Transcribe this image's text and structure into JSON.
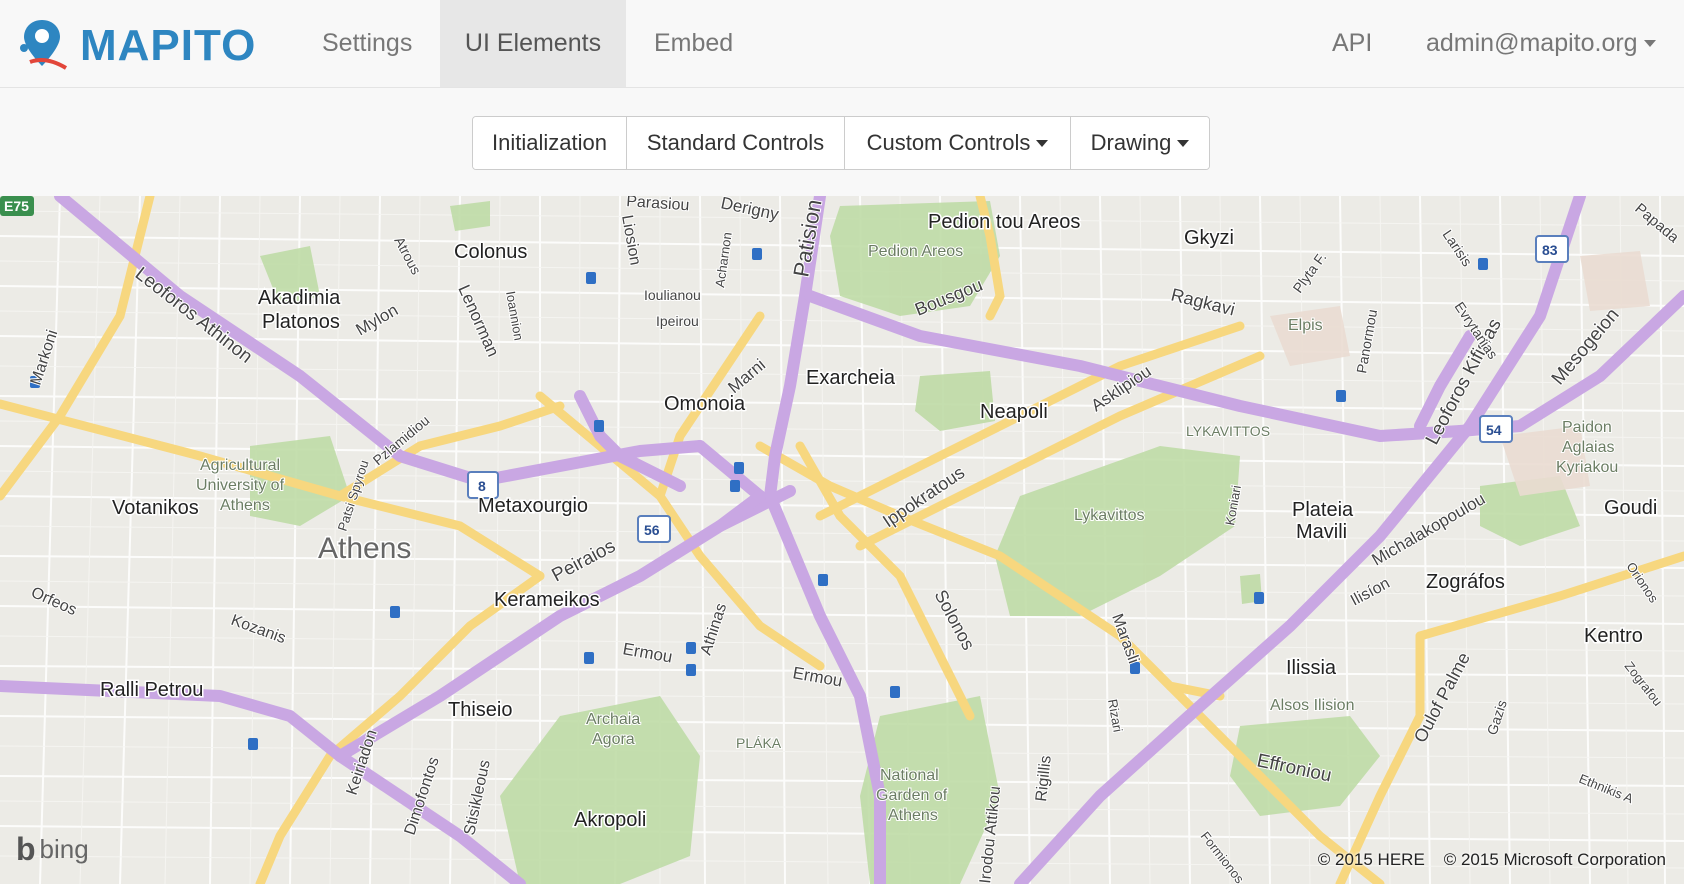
{
  "navbar": {
    "brand": "MAPITO",
    "links": [
      {
        "label": "Settings"
      },
      {
        "label": "UI Elements",
        "active": true
      },
      {
        "label": "Embed"
      }
    ],
    "api_label": "API",
    "user_label": "admin@mapito.org"
  },
  "toolbar": {
    "buttons": [
      {
        "label": "Initialization"
      },
      {
        "label": "Standard Controls"
      },
      {
        "label": "Custom Controls"
      },
      {
        "label": "Drawing"
      }
    ]
  },
  "map": {
    "labels": {
      "colonus": "Colonus",
      "akadimia": "Akadimia",
      "platonos": "Platonos",
      "omonoia": "Omonoia",
      "exarcheia": "Exarcheia",
      "neapoli": "Neapoli",
      "pedion_tou_areos": "Pedion tou Areos",
      "pedion_areos": "Pedion Areos",
      "gkyzi": "Gkyzi",
      "elpis": "Elpis",
      "lykavittos_area": "LYKAVITTOS",
      "lykavittos": "Lykavittos",
      "metaxourgio": "Metaxourgio",
      "athens": "Athens",
      "votanikos": "Votanikos",
      "agricultural": "Agricultural",
      "university_of": "University of",
      "athens_small": "Athens",
      "kerameikos": "Kerameikos",
      "thiseio": "Thiseio",
      "archaia": "Archaia",
      "agora": "Agora",
      "plaka": "PLÁKA",
      "akropoli": "Akropoli",
      "national": "National",
      "garden_of": "Garden of",
      "athens_garden": "Athens",
      "plateia": "Plateia",
      "mavili": "Mavili",
      "zografos": "Zográfos",
      "ilissia": "Ilissia",
      "alsos_ilision": "Alsos Ilision",
      "kentro": "Kentro",
      "goudi": "Goudi",
      "paidon": "Paidon",
      "aglaias": "Aglaias",
      "kyriakou": "Kyriakou",
      "leoforos_athinon": "Leoforos Athinon",
      "leoforos_kifisias": "Leoforos Kifisias",
      "mesogeion": "Mesogeion",
      "peiraios": "Peiraios",
      "ippokratous": "Ippokratous",
      "asklipiou": "Asklipiou",
      "solonos": "Solonos",
      "patision": "Patision",
      "bousgou": "Bousgou",
      "ragkavi": "Ragkavi",
      "marni": "Marni",
      "ermou": "Ermou",
      "ermou2": "Ermou",
      "ralli_petrou": "Ralli Petrou",
      "michalakopoulou": "Michalakopoulou",
      "efroniou": "Effroniou",
      "oulof_palme": "Oulof Palme",
      "ilision": "Ilisíon",
      "athinas": "Athinas",
      "mylon": "Mylon",
      "lenorman": "Lenorman",
      "liosion": "Liosion",
      "parasiou": "Parasiou",
      "derigny": "Derigny",
      "markoni": "Markoni",
      "orfeos": "Orfeos",
      "kozanis": "Kozanis",
      "keiriadon": "Keiriadon",
      "dimofontos": "Dimofontos",
      "stisikleous": "Stisikleous",
      "marasli": "Marasli",
      "rigillis": "Rigillis",
      "irodou_attikou": "Irodou Attikou",
      "plyta": "Plyta F.",
      "larisis": "Larisis",
      "evrytanias": "Evrytanias",
      "panormou": "Panormou",
      "papada": "Papada",
      "koniari": "Koniari",
      "pzlamidiou": "Pzlamidiou",
      "patsi_spyrou": "Patsi Spyrou",
      "ioulianou": "Ioulianou",
      "ipeirou": "Ipeirou",
      "acharnon": "Acharnon",
      "ioannion": "Ioannion",
      "atrous": "Atrous",
      "rizari": "Rizari",
      "gazis": "Gazis",
      "ethnikis": "Ethnikis A",
      "zografou": "Zografou",
      "orionos": "Orionos",
      "formionos": "Formionos"
    },
    "shields": [
      "E75",
      "8",
      "56",
      "54",
      "83"
    ],
    "attribution_here": "© 2015 HERE",
    "attribution_ms": "© 2015 Microsoft Corporation",
    "bing_text": "bing"
  },
  "colors": {
    "brand": "#2e86c1",
    "motorway": "#c9a7e3",
    "major_road": "#f7d77f",
    "park": "#bfdba6",
    "land": "#ecebe6"
  }
}
